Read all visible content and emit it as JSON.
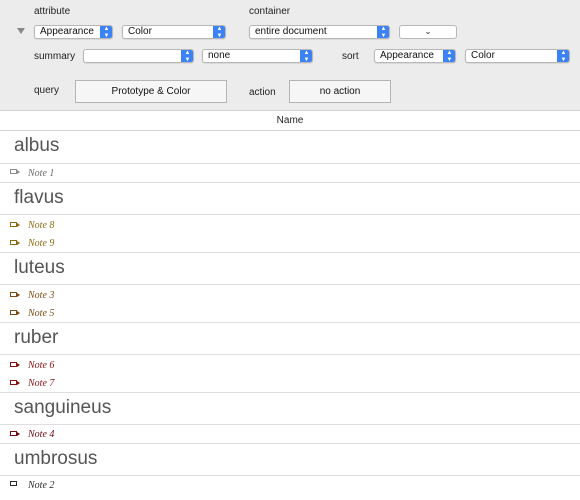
{
  "toolbar": {
    "attribute_label": "attribute",
    "container_label": "container",
    "summary_label": "summary",
    "sort_label": "sort",
    "query_label": "query",
    "action_label": "action",
    "attribute_value": "Appearance",
    "attribute_sub_value": "Color",
    "container_value": "entire document",
    "container_extra": "⌄",
    "summary_value": "",
    "summary_op": "none",
    "sort_value": "Appearance",
    "sort_sub_value": "Color",
    "query_button": "Prototype & Color",
    "action_button": "no action"
  },
  "table": {
    "column_name": "Name"
  },
  "groups": [
    {
      "name": "albus",
      "notes": [
        {
          "label": "Note 1",
          "color": "#6b6b6b"
        }
      ]
    },
    {
      "name": "flavus",
      "notes": [
        {
          "label": "Note 8",
          "color": "#8a6a10"
        },
        {
          "label": "Note 9",
          "color": "#8a6a10"
        }
      ]
    },
    {
      "name": "luteus",
      "notes": [
        {
          "label": "Note 3",
          "color": "#7a4a10"
        },
        {
          "label": "Note 5",
          "color": "#7a4a10"
        }
      ]
    },
    {
      "name": "ruber",
      "notes": [
        {
          "label": "Note 6",
          "color": "#8b1010"
        },
        {
          "label": "Note 7",
          "color": "#8b1010"
        }
      ]
    },
    {
      "name": "sanguineus",
      "notes": [
        {
          "label": "Note 4",
          "color": "#6e0a14"
        }
      ]
    },
    {
      "name": "umbrosus",
      "notes": [
        {
          "label": "Note 2",
          "color": "#2a2a2a"
        }
      ]
    }
  ]
}
